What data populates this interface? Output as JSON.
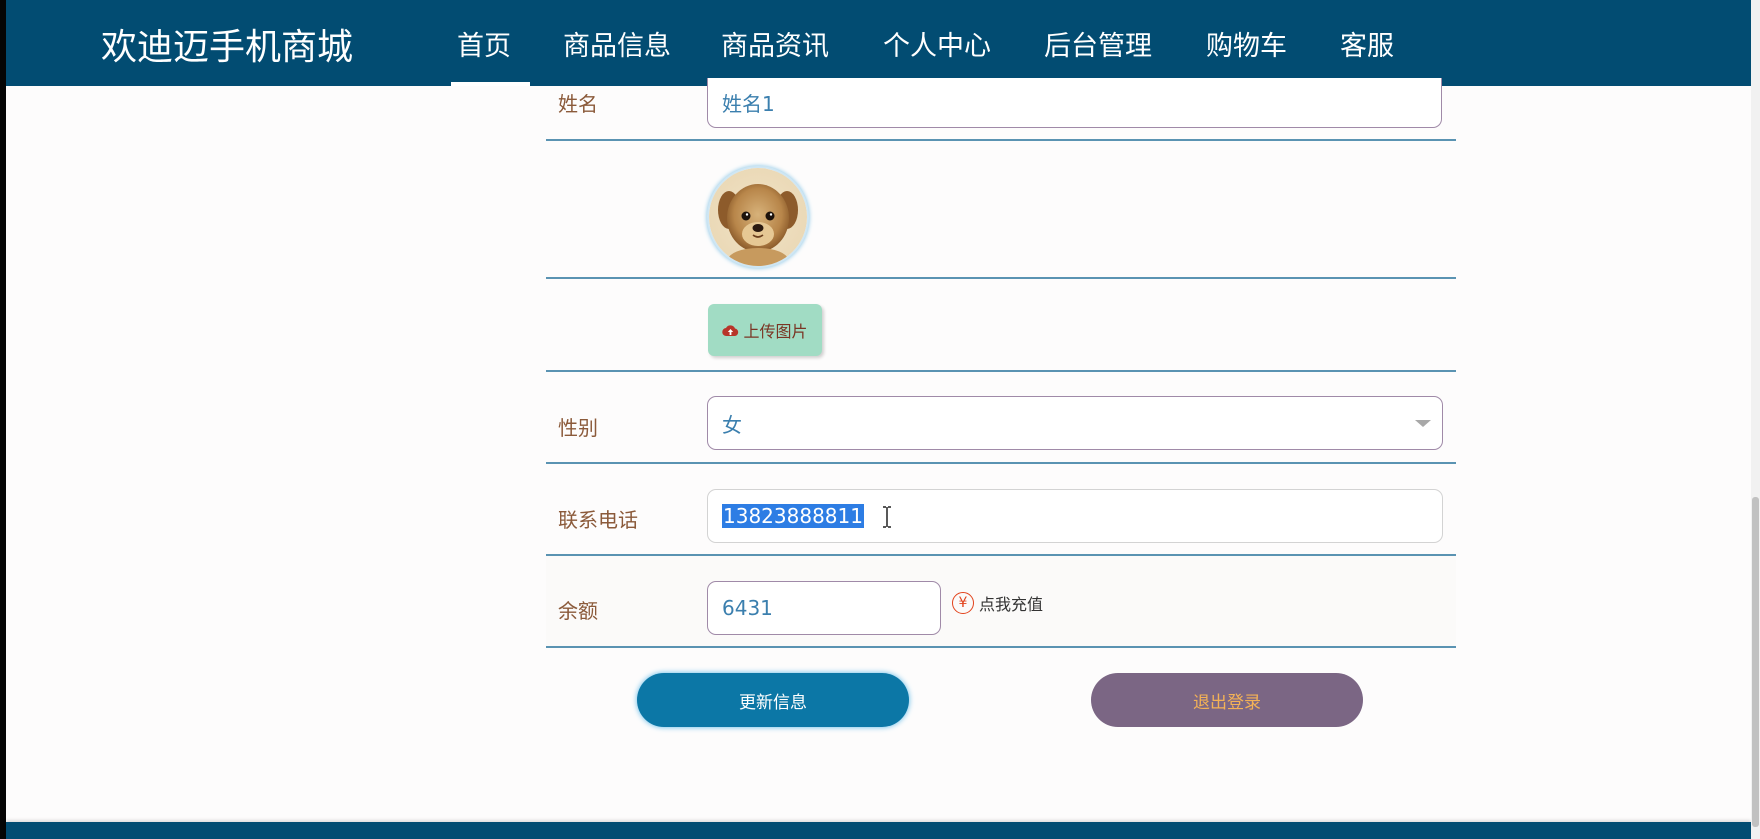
{
  "header": {
    "brand": "欢迪迈手机商城",
    "nav": [
      {
        "label": "首页",
        "active": true
      },
      {
        "label": "商品信息"
      },
      {
        "label": "商品资讯"
      },
      {
        "label": "个人中心"
      },
      {
        "label": "后台管理"
      },
      {
        "label": "购物车"
      },
      {
        "label": "客服"
      }
    ]
  },
  "form": {
    "name": {
      "label": "姓名",
      "value": "姓名1"
    },
    "avatar": {
      "icon": "puppy-photo"
    },
    "upload": {
      "label": "上传图片",
      "icon": "cloud-upload-icon"
    },
    "gender": {
      "label": "性别",
      "value": "女"
    },
    "phone": {
      "label": "联系电话",
      "value": "13823888811",
      "selected": true
    },
    "balance": {
      "label": "余额",
      "value": "6431"
    },
    "recharge": {
      "label": "点我充值",
      "icon": "yen-icon"
    }
  },
  "actions": {
    "update_label": "更新信息",
    "logout_label": "退出登录"
  },
  "colors": {
    "header_bg": "#024c72",
    "update_button": "#0c77a6",
    "logout_button": "#7b6684",
    "upload_button": "#a1dcc4",
    "text_selection": "#2d7de4"
  }
}
